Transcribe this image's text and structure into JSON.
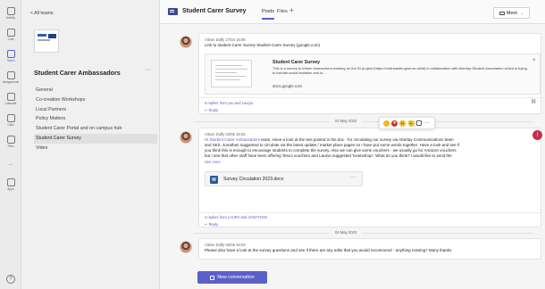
{
  "rail": {
    "items": [
      {
        "label": "Activity"
      },
      {
        "label": "Chat"
      },
      {
        "label": "Teams"
      },
      {
        "label": "Assignments"
      },
      {
        "label": "Calendar"
      },
      {
        "label": "Calls"
      },
      {
        "label": "Files"
      },
      {
        "label": "..."
      },
      {
        "label": "Apps"
      }
    ],
    "help": "?"
  },
  "sidebar": {
    "back_label": "< All teams",
    "team_name": "Student Carer Ambassadors",
    "more": "···",
    "channels": [
      {
        "label": "General"
      },
      {
        "label": "Co-creation Workshops"
      },
      {
        "label": "Local Partners"
      },
      {
        "label": "Policy Matters"
      },
      {
        "label": "Student Carer Portal and on campus hub"
      },
      {
        "label": "Student Carer Survey"
      },
      {
        "label": "Video"
      }
    ]
  },
  "header": {
    "channel_title": "Student Carer Survey",
    "tabs": [
      {
        "label": "Posts"
      },
      {
        "label": "Files"
      },
      {
        "label": "+"
      }
    ],
    "meet_label": "Meet",
    "meet_chevron": "⌄"
  },
  "posts": [
    {
      "author_time": "Alison Duffy  27/04 16:08",
      "text": "Link to student Carer Survey Student Carer Survey (google.com)",
      "link_preview": {
        "title": "Student Carer Survey",
        "description": "This is a survey to inform researchers working on the ID project (https://northeastengine.ac.uk/id) in collaboration with Abertay Student Association which is trying to include social isolation and lo...",
        "domain": "docs.google.com",
        "close": "×"
      },
      "replies_text": "6 replies from you and Lauryn",
      "reply_label": "↩ Reply"
    },
    {
      "date_separator": "03 May 2023",
      "author_time": "Alison Duffy  03/05 18:03",
      "mention": "Hi Student Carer Ambassadors",
      "text_lines": [
        "team, Have a look at the text posted in the doc - for circulating our survey via Abertay Communications team",
        "and SEZ. Jonathan suggested to circulate via the latest update / market place pages so I have put some words together. Have a look and see if",
        "you think this is enough to encourage students to complete the survey. Also we can give some vouchers - we usually go for Amazon vouchers",
        "but I see that other staff have been offering Tesco vouchers and Lauryn suggested 'lovetoshop'. What do you think? I would like to send the"
      ],
      "see_more": "See more",
      "file_name": "Survey Circulation 2023.docx",
      "file_more": "···",
      "replies_text": "2 replies from LAURA and JONATHAN",
      "reply_label": "↩ Reply",
      "reactions": {
        "like": "👍",
        "heart": "♥",
        "laugh": "😆",
        "surprise": "😮",
        "more": "···"
      },
      "urgent": "!"
    },
    {
      "date_separator": "04 May 2023",
      "author_time": "Alison Duffy  05/05 16:03",
      "text": "Please also have a look at the survey questions and see if there are any edits that you would recommend - anything missing? Many thanks"
    }
  ],
  "new_conversation_label": "New conversation"
}
